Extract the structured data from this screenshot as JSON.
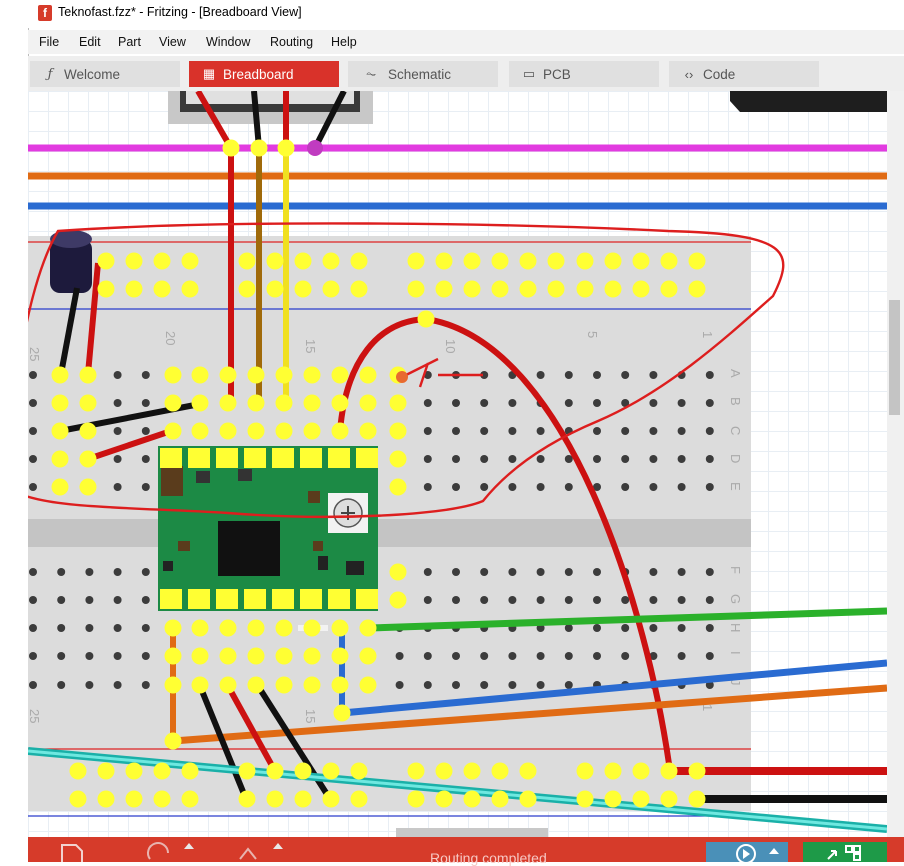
{
  "window": {
    "title": "Teknofast.fzz* - Fritzing - [Breadboard View]",
    "app_icon": "f"
  },
  "menu": [
    "File",
    "Edit",
    "Part",
    "View",
    "Window",
    "Routing",
    "Help"
  ],
  "tabs": [
    {
      "label": "Welcome",
      "icon": "ƒ",
      "active": false
    },
    {
      "label": "Breadboard",
      "icon": "▦",
      "active": true
    },
    {
      "label": "Schematic",
      "icon": "⏦",
      "active": false
    },
    {
      "label": "PCB",
      "icon": "▭",
      "active": false
    },
    {
      "label": "Code",
      "icon": "‹›",
      "active": false
    }
  ],
  "breadboard": {
    "column_numbers": [
      "25",
      "20",
      "15",
      "10",
      "5",
      "1"
    ],
    "row_letters_top": [
      "A",
      "B",
      "C",
      "D",
      "E"
    ],
    "row_letters_bottom": [
      "F",
      "G",
      "H",
      "I",
      "J"
    ]
  },
  "status": {
    "message": "Routing completed"
  },
  "colors": {
    "accent": "#d63b2a",
    "connected_pin": "#ffff33",
    "tab_inactive": "#e0e0e0"
  },
  "icons": [
    "new-file-icon",
    "rotate-icon",
    "flip-icon",
    "play-icon",
    "routing-icon"
  ]
}
